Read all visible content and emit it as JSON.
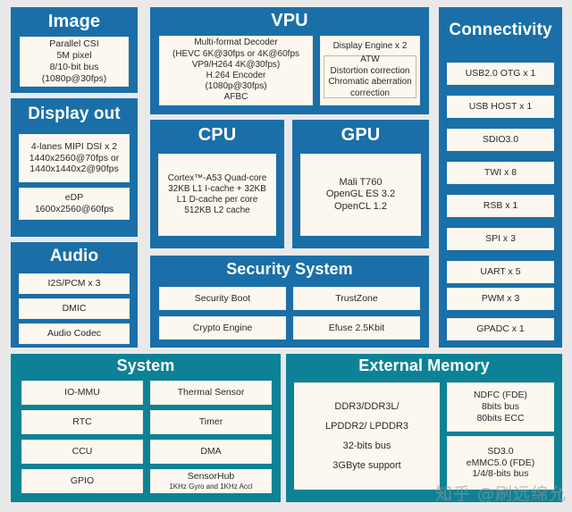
{
  "colors": {
    "blue": "#1a6fa8",
    "teal": "#0d8296",
    "cell": "#fdf8ef",
    "background": "#e9e9e9",
    "subbox_border": "#c9b99a"
  },
  "blocks": {
    "image": {
      "title": "Image",
      "cell": [
        "Parallel CSI",
        "5M pixel",
        "8/10-bit bus",
        "(1080p@30fps)"
      ]
    },
    "display_out": {
      "title": "Display out",
      "dsi": [
        "4-lanes MIPI DSI x 2",
        "1440x2560@70fps or",
        "1440x1440x2@90fps"
      ],
      "edp": [
        "eDP",
        "1600x2560@60fps"
      ]
    },
    "audio": {
      "title": "Audio",
      "items": [
        "I2S/PCM x 3",
        "DMIC",
        "Audio Codec"
      ]
    },
    "vpu": {
      "title": "VPU",
      "decoder": [
        "Multi-format Decoder",
        "(HEVC 6K@30fps or 4K@60fps",
        "VP9/H264 4K@30fps)",
        "H.264 Encoder",
        "(1080p@30fps)",
        "AFBC"
      ],
      "display_engine_label": "Display Engine x 2",
      "display_engine_sub": [
        "ATW",
        "Distortion correction",
        "Chromatic aberration",
        "correction"
      ]
    },
    "cpu": {
      "title": "CPU",
      "cell": [
        "Cortex™-A53 Quad-core",
        "32KB L1 I-cache + 32KB",
        "L1 D-cache per core",
        "512KB L2 cache"
      ]
    },
    "gpu": {
      "title": "GPU",
      "cell": [
        "Mali T760",
        "OpenGL ES 3.2",
        "OpenCL 1.2"
      ]
    },
    "security": {
      "title": "Security System",
      "items": [
        "Security Boot",
        "TrustZone",
        "Crypto Engine",
        "Efuse 2.5Kbit"
      ]
    },
    "connectivity": {
      "title": "Connectivity",
      "items": [
        "USB2.0 OTG x 1",
        "USB HOST x 1",
        "SDIO3.0",
        "TWI x 8",
        "RSB x 1",
        "SPI x 3",
        "UART x 5",
        "PWM x 3",
        "GPADC x 1"
      ]
    },
    "system": {
      "title": "System",
      "items": [
        "IO-MMU",
        "Thermal Sensor",
        "RTC",
        "Timer",
        "CCU",
        "DMA",
        "GPIO",
        "SensorHub"
      ],
      "sensorhub_sub": "1KHz Gyro and 1KHz Accl"
    },
    "external_memory": {
      "title": "External Memory",
      "ddr": [
        "DDR3/DDR3L/",
        "LPDDR2/ LPDDR3",
        "32-bits bus",
        "3GByte support"
      ],
      "ndfc": [
        "NDFC (FDE)",
        "8bits bus",
        "80bits ECC"
      ],
      "sd": [
        "SD3.0",
        "eMMC5.0 (FDE)",
        "1/4/8-bits bus"
      ]
    }
  },
  "watermark": "知乎 @刷远绵允"
}
